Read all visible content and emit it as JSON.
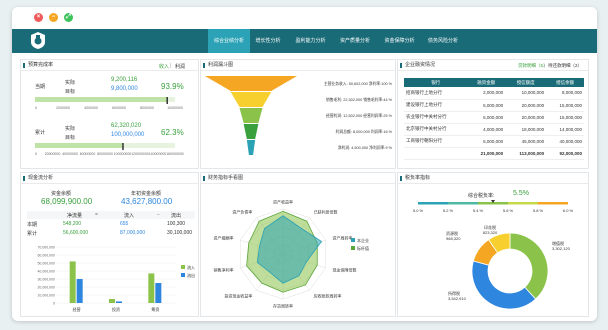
{
  "window": {
    "controls": [
      "close",
      "minimize",
      "maximize"
    ]
  },
  "nav": {
    "items": [
      "综合业绩分析",
      "增长性分析",
      "盈利能力分析",
      "资产质量分析",
      "资金保障分析",
      "债务风险分析"
    ],
    "active": 0
  },
  "colors": {
    "nav_bg": "#1a6b78",
    "accent": "#2ba2b5",
    "green": "#3aa03e",
    "blue": "#2e86de",
    "lime": "#8bc34a",
    "orange": "#f5a623"
  },
  "budget": {
    "title": "预算完成率",
    "tabs": [
      "收入",
      "利润"
    ],
    "current": {
      "label": "当期",
      "actual_label": "实际",
      "target_label": "目标",
      "actual": "9,200,116",
      "target": "9,800,000",
      "pct": "93.9%",
      "scale": [
        "0",
        "2000000",
        "4000000",
        "6000000",
        "8000000",
        "10000000"
      ],
      "fill": 0.939
    },
    "cumulative": {
      "label": "累计",
      "actual_label": "实际",
      "target_label": "目标",
      "actual": "62,320,020",
      "target": "100,000,000",
      "pct": "62.3%",
      "scale": [
        "0",
        "20000000",
        "40000000",
        "60000000",
        "80000000",
        "100000000",
        "120000000",
        "140000000",
        "160000000"
      ],
      "fill": 0.623
    }
  },
  "funnel": {
    "title": "利润漏斗图",
    "rows": [
      {
        "text": "主营业务收入: 50,602,000 净利率:100 %",
        "value": 100
      },
      {
        "text": "销售毛利: 22,302,000 销售毛利率:44 %",
        "value": 44
      },
      {
        "text": "经营利润: 12,502,000 经营利润率:25 %",
        "value": 25
      },
      {
        "text": "利润总额: 8,000,000 利润率:16 %",
        "value": 16
      },
      {
        "text": "净利润: 4,500,000 净利润率:9 %",
        "value": 9
      }
    ]
  },
  "finance": {
    "title": "企业融资情况",
    "links": [
      "贷款明细（5）",
      "待还款明细（2）"
    ],
    "headers": [
      "银行",
      "融资金额",
      "授信额度",
      "授信余额"
    ],
    "rows": [
      [
        "招商银行上地分行",
        "2,000,000",
        "10,000,000",
        "8,000,000"
      ],
      [
        "建设银行上地分行",
        "5,000,000",
        "20,000,000",
        "15,000,000"
      ],
      [
        "农业银行中关村分行",
        "5,000,000",
        "20,000,000",
        "15,000,000"
      ],
      [
        "北京银行中关村分行",
        "4,000,000",
        "18,000,000",
        "14,000,000"
      ],
      [
        "工商银行朝阳分行",
        "5,000,000",
        "45,000,000",
        "40,000,000"
      ]
    ],
    "totals": [
      "",
      "21,000,000",
      "113,000,000",
      "92,000,000"
    ]
  },
  "cash": {
    "title": "现金流分析",
    "balance_label": "资金余额",
    "balance": "68,099,900.00",
    "year_balance_label": "年初资金余额",
    "year_balance": "43,627,800.00",
    "cols": [
      "净流量",
      "流入",
      "流出"
    ],
    "rows": [
      {
        "label": "本期",
        "values": [
          "548,200",
          "655",
          "100,300"
        ]
      },
      {
        "label": "累计",
        "values": [
          "56,600,000",
          "87,000,000",
          "30,100,000"
        ]
      }
    ],
    "y_axis": [
      "70,000,000",
      "60,000,000",
      "50,000,000",
      "40,000,000",
      "30,000,000",
      "20,000,000",
      "10,000,000",
      "0"
    ],
    "categories": [
      "经营",
      "投资",
      "筹资"
    ],
    "legend": [
      "流入",
      "流出"
    ]
  },
  "chart_data": [
    {
      "type": "bar",
      "categories": [
        "经营",
        "投资",
        "筹资"
      ],
      "series": [
        {
          "name": "流入",
          "values": [
            52000000,
            5000000,
            37000000
          ]
        },
        {
          "name": "流出",
          "values": [
            30000000,
            2000000,
            25000000
          ]
        }
      ],
      "ylim": [
        0,
        70000000
      ]
    },
    {
      "type": "radar",
      "title": "财务指标手看图",
      "categories": [
        "资产收益率",
        "已获利息倍数",
        "资产周转率",
        "现金保障倍数",
        "应收账款周转率",
        "存货周转率",
        "投资现金收益率",
        "销售净利率",
        "资产报酬率",
        "资产负债率"
      ],
      "series": [
        {
          "name": "本企业",
          "values": [
            0.85,
            0.7,
            0.9,
            0.55,
            0.6,
            0.65,
            0.5,
            0.6,
            0.55,
            0.7
          ]
        },
        {
          "name": "标杆值",
          "values": [
            0.95,
            0.9,
            0.8,
            0.8,
            0.85,
            0.85,
            0.8,
            0.85,
            0.8,
            0.9
          ]
        }
      ]
    },
    {
      "type": "pie",
      "title": "税负率指标",
      "slices": [
        {
          "name": "增值税",
          "value": 3302120
        },
        {
          "name": "所得税",
          "value": 3542910
        },
        {
          "name": "资源税",
          "value": 968320
        },
        {
          "name": "印花税",
          "value": 823320
        }
      ]
    }
  ],
  "radar": {
    "title": "财务指标手看图",
    "legend": [
      "本企业",
      "标杆值"
    ]
  },
  "tax": {
    "title": "税负率指标",
    "rate_label": "综合税负率:",
    "rate": "5.5%",
    "scale": [
      "5.0 %",
      "5.2 %",
      "5.4 %",
      "5.6 %",
      "5.8 %",
      "6.0 %"
    ],
    "slices": [
      {
        "name": "增值税",
        "value": "3,302,120"
      },
      {
        "name": "所得税",
        "value": "3,542,910"
      },
      {
        "name": "资源税",
        "value": "968,320"
      },
      {
        "name": "印花税",
        "value": "823,320"
      }
    ]
  }
}
